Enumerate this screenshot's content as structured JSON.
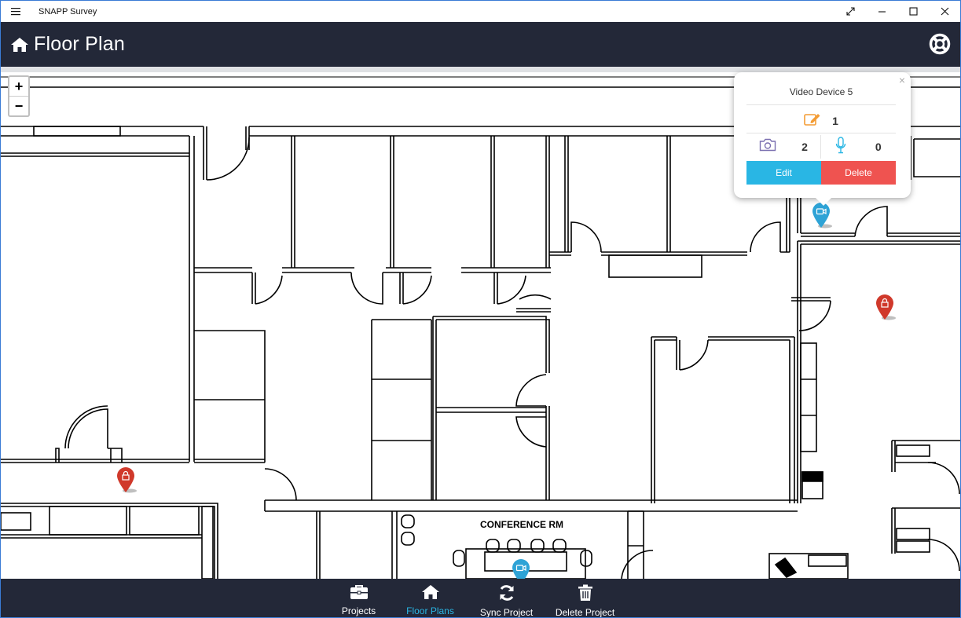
{
  "window": {
    "app_title": "SNAPP Survey",
    "menu_icon": "hamburger-icon",
    "controls": [
      "expand-icon",
      "minimize-icon",
      "maximize-icon",
      "close-icon"
    ]
  },
  "header": {
    "title": "Floor Plan",
    "home_icon": "home-icon",
    "help_icon": "lifebuoy-icon"
  },
  "map": {
    "zoom_in": "+",
    "zoom_out": "−",
    "room_label": "CONFERENCE RM",
    "markers": [
      {
        "type": "lock",
        "color": "#d0392b"
      },
      {
        "type": "lock",
        "color": "#d0392b"
      },
      {
        "type": "video",
        "color": "#2ea3d6"
      },
      {
        "type": "video",
        "color": "#2ea3d6"
      }
    ]
  },
  "popup": {
    "title": "Video Device 5",
    "close": "×",
    "notes_count": "1",
    "photo_count": "2",
    "audio_count": "0",
    "edit_label": "Edit",
    "delete_label": "Delete"
  },
  "bottom_nav": {
    "items": [
      {
        "label": "Projects",
        "icon": "briefcase-icon"
      },
      {
        "label": "Floor Plans",
        "icon": "home-icon",
        "active": true
      },
      {
        "label": "Sync Project",
        "icon": "sync-icon"
      },
      {
        "label": "Delete Project",
        "icon": "trash-icon"
      }
    ]
  },
  "colors": {
    "header_bg": "#232838",
    "accent": "#29b6e4",
    "danger": "#ef5350",
    "edit_icon": "#f39c34",
    "photo_icon": "#7a6fb0",
    "mic_icon": "#29b6e4"
  }
}
